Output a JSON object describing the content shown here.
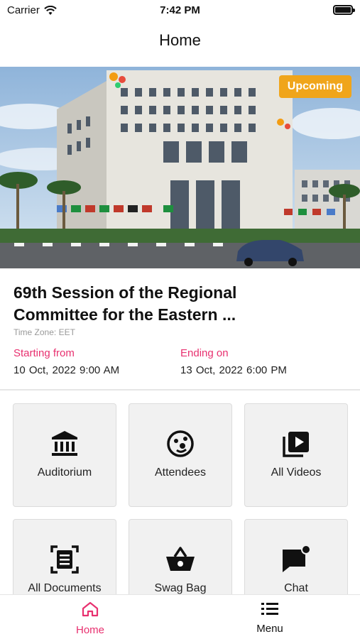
{
  "status_bar": {
    "carrier": "Carrier",
    "time": "7:42 PM",
    "wifi_icon": "wifi-icon",
    "battery_icon": "battery-icon"
  },
  "nav": {
    "title": "Home"
  },
  "event": {
    "badge": "Upcoming",
    "title_line1": "69th Session of the Regional",
    "title_line2": "Committee for the Eastern ...",
    "timezone": "Time Zone: EET",
    "start_label": "Starting from",
    "start_value": "10 Oct, 2022   9:00 AM",
    "end_label": "Ending on",
    "end_value": "13 Oct, 2022   6:00 PM"
  },
  "tiles": [
    {
      "label": "Auditorium",
      "icon": "bank-icon"
    },
    {
      "label": "Attendees",
      "icon": "attendees-face-icon"
    },
    {
      "label": "All Videos",
      "icon": "video-library-icon"
    },
    {
      "label": "All Documents",
      "icon": "document-scan-icon"
    },
    {
      "label": "Swag Bag",
      "icon": "basket-icon"
    },
    {
      "label": "Chat",
      "icon": "chat-bubble-icon"
    }
  ],
  "tab_bar": {
    "home": {
      "label": "Home",
      "icon": "home-icon"
    },
    "menu": {
      "label": "Menu",
      "icon": "list-icon"
    }
  },
  "colors": {
    "accent": "#e8306f",
    "badge": "#f0a51b",
    "tile_bg": "#f1f1f1"
  }
}
